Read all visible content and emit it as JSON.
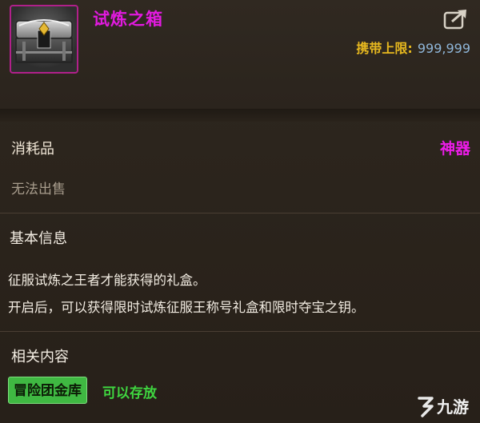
{
  "item": {
    "name": "试炼之箱",
    "limit_label": "携带上限:",
    "limit_value": "999,999",
    "icon": "treasure-chest-icon"
  },
  "info": {
    "category": "消耗品",
    "rarity": "神器",
    "trade_status": "无法出售"
  },
  "basic_info": {
    "title": "基本信息",
    "lines": [
      "征服试炼之王者才能获得的礼盒。",
      "开启后，可以获得限时试炼征服王称号礼盒和限时夺宝之钥。"
    ]
  },
  "related": {
    "title": "相关内容",
    "button": "冒险团金库",
    "note": "可以存放"
  },
  "watermark": {
    "text": "九游"
  },
  "colors": {
    "background": "#2b241c",
    "rarity": "#e21ae0",
    "limit_label": "#e7b81f",
    "limit_value": "#8fb6d9",
    "accent_green": "#3fb842"
  }
}
